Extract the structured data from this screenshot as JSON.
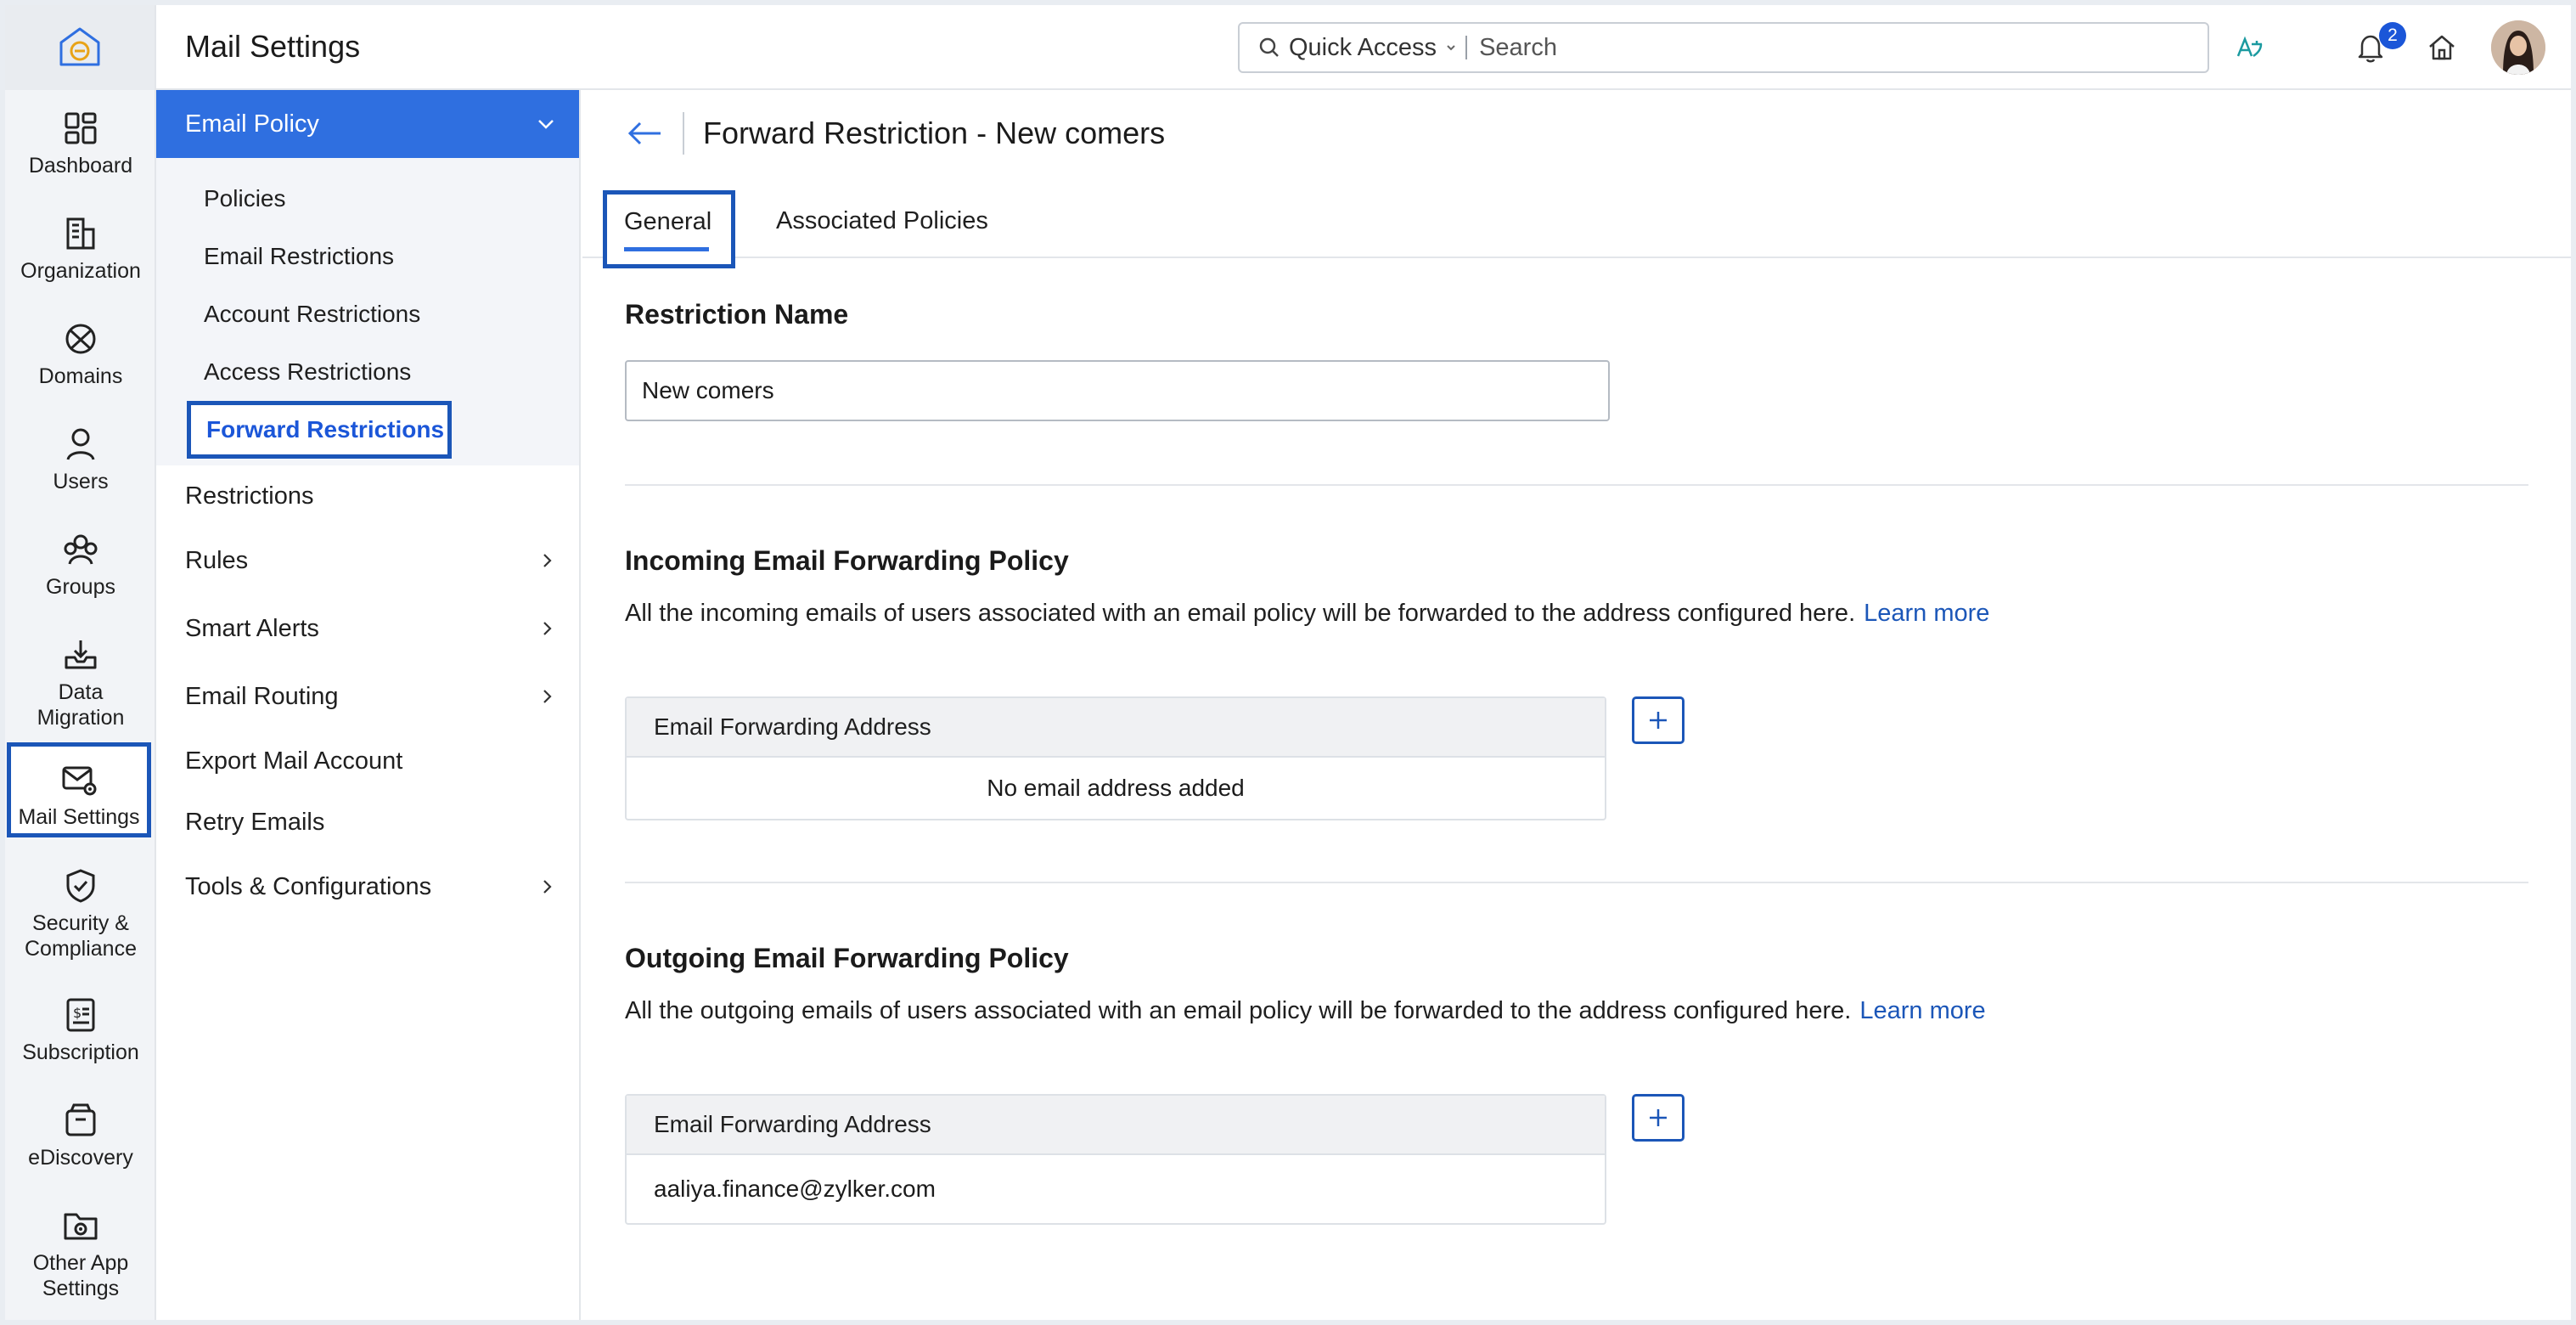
{
  "app": {
    "title": "Mail Settings"
  },
  "search": {
    "quick_access": "Quick Access",
    "placeholder": "Search"
  },
  "notifications": {
    "count": "2"
  },
  "rail": {
    "items": [
      {
        "label": "Dashboard",
        "icon": "grid-icon"
      },
      {
        "label": "Organization",
        "icon": "building-icon"
      },
      {
        "label": "Domains",
        "icon": "globe-icon"
      },
      {
        "label": "Users",
        "icon": "user-icon"
      },
      {
        "label": "Groups",
        "icon": "group-icon"
      },
      {
        "label": "Data\nMigration",
        "icon": "download-tray-icon"
      },
      {
        "label": "Mail Settings",
        "icon": "mail-gear-icon"
      },
      {
        "label": "Security &\nCompliance",
        "icon": "shield-check-icon"
      },
      {
        "label": "Subscription",
        "icon": "receipt-dollar-icon"
      },
      {
        "label": "eDiscovery",
        "icon": "archive-box-icon"
      },
      {
        "label": "Other App\nSettings",
        "icon": "folder-gear-icon"
      }
    ]
  },
  "sidebar": {
    "group_label": "Email Policy",
    "sub_items": [
      "Policies",
      "Email Restrictions",
      "Account Restrictions",
      "Access Restrictions",
      "Forward Restrictions"
    ],
    "items": [
      {
        "label": "Restrictions",
        "chevron": false
      },
      {
        "label": "Rules",
        "chevron": true
      },
      {
        "label": "Smart Alerts",
        "chevron": true
      },
      {
        "label": "Email Routing",
        "chevron": true
      },
      {
        "label": "Export Mail Account",
        "chevron": false
      },
      {
        "label": "Retry Emails",
        "chevron": false
      },
      {
        "label": "Tools & Configurations",
        "chevron": true
      }
    ]
  },
  "main": {
    "page_title": "Forward Restriction - New comers",
    "tabs": [
      "General",
      "Associated Policies"
    ],
    "restriction_name_label": "Restriction Name",
    "restriction_name_value": "New comers",
    "incoming": {
      "title": "Incoming Email Forwarding Policy",
      "description": "All the incoming emails of users associated with an email policy will be forwarded to the address configured here.",
      "learn_more": "Learn more",
      "table_header": "Email Forwarding Address",
      "empty_text": "No email address added"
    },
    "outgoing": {
      "title": "Outgoing Email Forwarding Policy",
      "description": "All the outgoing emails of users associated with an email policy will be forwarded to the address configured here.",
      "learn_more": "Learn more",
      "table_header": "Email Forwarding Address",
      "address": "aaliya.finance@zylker.com"
    }
  },
  "colors": {
    "accent": "#2f6fe0",
    "highlight_border": "#1b56b8",
    "link": "#1b56b8"
  }
}
